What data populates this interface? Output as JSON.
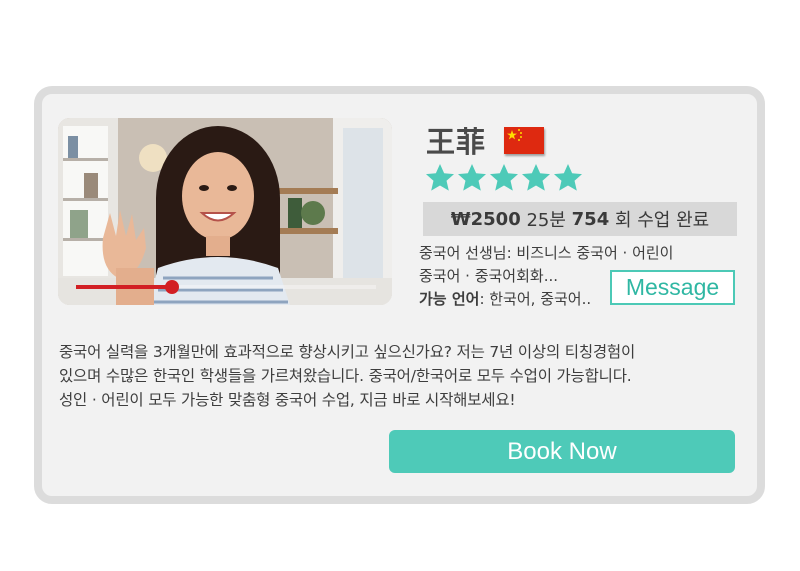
{
  "tutor": {
    "name": "王菲",
    "flag_icon": "china-flag-icon",
    "rating": 5,
    "rating_max": 5,
    "star_color": "#4ecab8"
  },
  "stats": {
    "price": "₩2500",
    "duration": "25분",
    "lessons_count": "754",
    "lessons_suffix": "회 수업 완료"
  },
  "subjects": {
    "line1": "중국어 선생님: 비즈니스 중국어 · 어린이",
    "line2": "중국어 · 중국어회화...",
    "languages_label": "가능 언어",
    "languages_value": ": 한국어, 중국어.."
  },
  "video": {
    "progress": 0.32,
    "progress_color": "#d21f24"
  },
  "buttons": {
    "message_label": "Message",
    "book_label": "Book Now",
    "accent_color": "#4ecab8"
  },
  "description": {
    "line1": "중국어 실력을 3개월만에 효과적으로 향상시키고 싶으신가요? 저는 7년 이상의 티칭경험이",
    "line2": "있으며 수많은 한국인 학생들을 가르쳐왔습니다. 중국어/한국어로 모두 수업이 가능합니다.",
    "line3": "성인 · 어린이 모두 가능한 맞춤형 중국어 수업, 지금 바로 시작해보세요!"
  }
}
